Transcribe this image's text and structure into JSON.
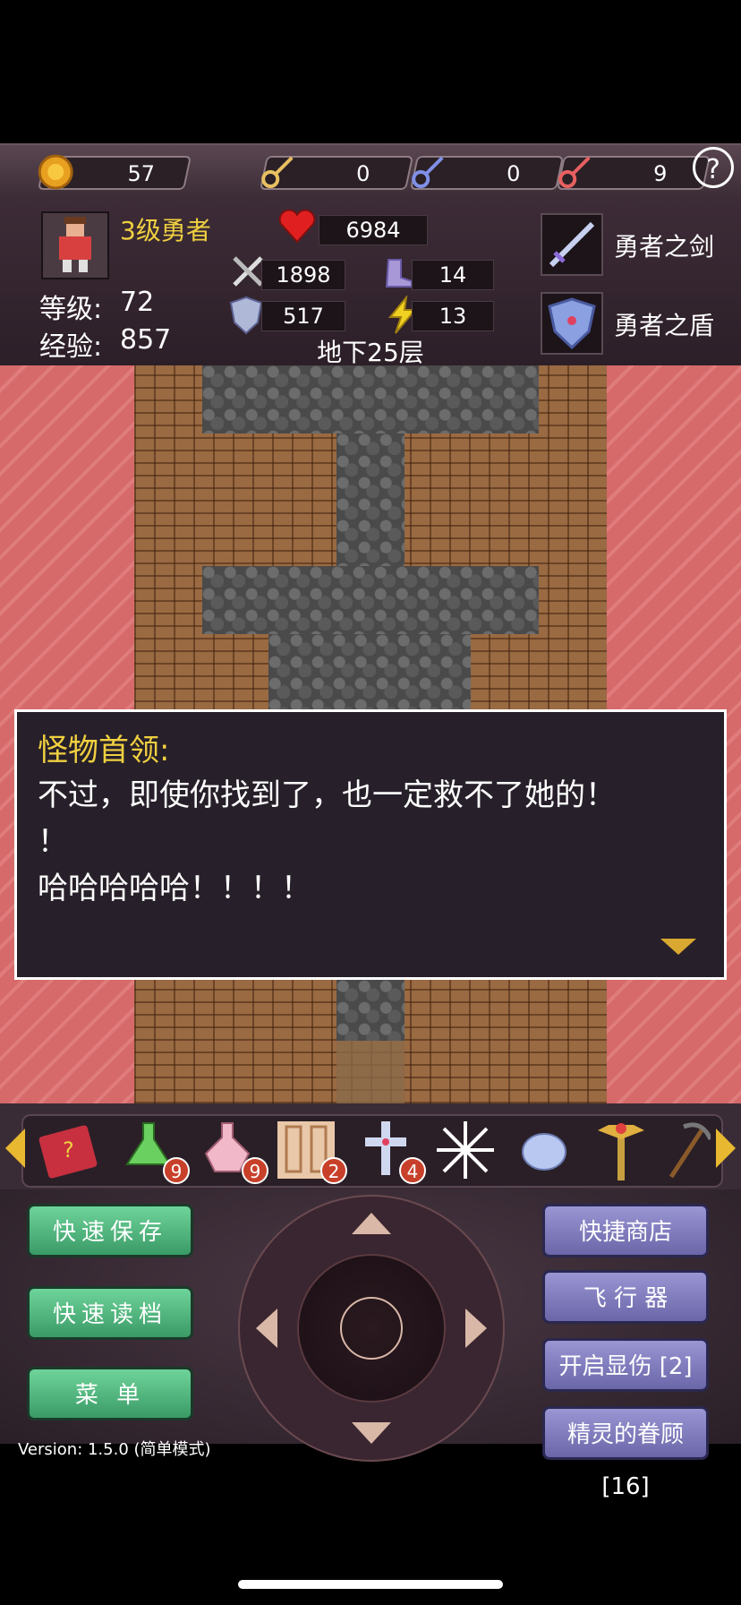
{
  "resources": {
    "coins": "57",
    "yellow_keys": "0",
    "blue_keys": "0",
    "red_keys": "9",
    "help_label": "?"
  },
  "hero": {
    "title": "3级勇者",
    "level_label": "等级:",
    "level": "72",
    "exp_label": "经验:",
    "exp": "857",
    "hp": "6984",
    "attack": "1898",
    "defense": "517",
    "magic_defense": "14",
    "agility": "13"
  },
  "equipment": {
    "weapon": "勇者之剑",
    "shield": "勇者之盾"
  },
  "floor": "地下25层",
  "dialog": {
    "speaker": "怪物首领:",
    "text": "不过，即使你找到了，也一定救不了她的！\n！\n哈哈哈哈哈！！！！"
  },
  "items": [
    {
      "name": "monster-book",
      "count": ""
    },
    {
      "name": "green-potion",
      "count": "9"
    },
    {
      "name": "pink-potion",
      "count": "9"
    },
    {
      "name": "scroll",
      "count": "2"
    },
    {
      "name": "cross-amulet",
      "count": "4"
    },
    {
      "name": "snowflake",
      "count": ""
    },
    {
      "name": "orb",
      "count": ""
    },
    {
      "name": "staff",
      "count": ""
    },
    {
      "name": "pickaxe",
      "count": ""
    }
  ],
  "buttons": {
    "quick_save": "快速保存",
    "quick_load": "快速读档",
    "menu": "菜 单",
    "quick_shop": "快捷商店",
    "fly": "飞 行 器",
    "show_damage": "开启显伤 [2]",
    "fairy": "精灵的眷顾 [16]"
  },
  "version": "Version: 1.5.0 (简单模式)",
  "colors": {
    "accent_yellow": "#f0d040",
    "lava": "#d86e6e",
    "green_button": "#4fb27c",
    "purple_button": "#8480c0"
  }
}
